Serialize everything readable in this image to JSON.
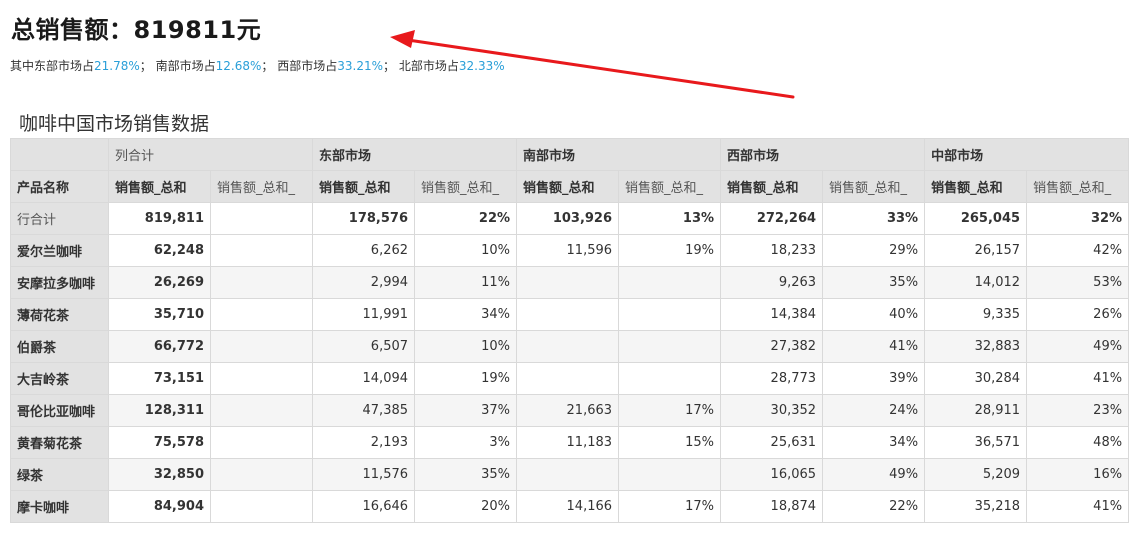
{
  "header": {
    "headline": "总销售额：819811元",
    "summary": [
      {
        "label": "其中东部市场占",
        "pct": "21.78%",
        "sep": "；"
      },
      {
        "label": "南部市场占",
        "pct": "12.68%",
        "sep": "；"
      },
      {
        "label": "西部市场占",
        "pct": "33.21%",
        "sep": "；"
      },
      {
        "label": "北部市场占",
        "pct": "32.33%",
        "sep": ""
      }
    ]
  },
  "annotation": {
    "color": "#e8191c"
  },
  "table": {
    "title": "咖啡中国市场销售数据",
    "group_headers": [
      "列合计",
      "东部市场",
      "南部市场",
      "西部市场",
      "中部市场"
    ],
    "row_header_label": "产品名称",
    "measure_headers": [
      "销售额_总和",
      "销售额_总和_",
      "销售额_总和",
      "销售额_总和_",
      "销售额_总和",
      "销售额_总和_",
      "销售额_总和",
      "销售额_总和_",
      "销售额_总和",
      "销售额_总和_"
    ],
    "rows": [
      {
        "name": "行合计",
        "cells": [
          "819,811",
          "",
          "178,576",
          "22%",
          "103,926",
          "13%",
          "272,264",
          "33%",
          "265,045",
          "32%"
        ]
      },
      {
        "name": "爱尔兰咖啡",
        "cells": [
          "62,248",
          "",
          "6,262",
          "10%",
          "11,596",
          "19%",
          "18,233",
          "29%",
          "26,157",
          "42%"
        ]
      },
      {
        "name": "安摩拉多咖啡",
        "cells": [
          "26,269",
          "",
          "2,994",
          "11%",
          "",
          "",
          "9,263",
          "35%",
          "14,012",
          "53%"
        ]
      },
      {
        "name": "薄荷花茶",
        "cells": [
          "35,710",
          "",
          "11,991",
          "34%",
          "",
          "",
          "14,384",
          "40%",
          "9,335",
          "26%"
        ]
      },
      {
        "name": "伯爵茶",
        "cells": [
          "66,772",
          "",
          "6,507",
          "10%",
          "",
          "",
          "27,382",
          "41%",
          "32,883",
          "49%"
        ]
      },
      {
        "name": "大吉岭茶",
        "cells": [
          "73,151",
          "",
          "14,094",
          "19%",
          "",
          "",
          "28,773",
          "39%",
          "30,284",
          "41%"
        ]
      },
      {
        "name": "哥伦比亚咖啡",
        "cells": [
          "128,311",
          "",
          "47,385",
          "37%",
          "21,663",
          "17%",
          "30,352",
          "24%",
          "28,911",
          "23%"
        ]
      },
      {
        "name": "黄春菊花茶",
        "cells": [
          "75,578",
          "",
          "2,193",
          "3%",
          "11,183",
          "15%",
          "25,631",
          "34%",
          "36,571",
          "48%"
        ]
      },
      {
        "name": "绿茶",
        "cells": [
          "32,850",
          "",
          "11,576",
          "35%",
          "",
          "",
          "16,065",
          "49%",
          "5,209",
          "16%"
        ]
      },
      {
        "name": "摩卡咖啡",
        "cells": [
          "84,904",
          "",
          "16,646",
          "20%",
          "14,166",
          "17%",
          "18,874",
          "22%",
          "35,218",
          "41%"
        ]
      }
    ]
  }
}
